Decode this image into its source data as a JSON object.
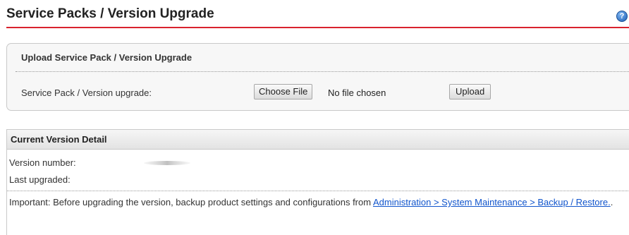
{
  "header": {
    "title": "Service Packs / Version Upgrade",
    "help_icon": "help-icon",
    "accent_color": "#d9232e"
  },
  "upload_panel": {
    "heading": "Upload Service Pack / Version Upgrade",
    "field_label": "Service Pack / Version upgrade:",
    "choose_file_label": "Choose File",
    "file_status": "No file chosen",
    "upload_label": "Upload"
  },
  "version_detail": {
    "heading": "Current Version Detail",
    "version_number_label": "Version number:",
    "version_number_value": "",
    "last_upgraded_label": "Last upgraded:",
    "last_upgraded_value": "",
    "note_prefix": "Important: Before upgrading the version, backup product settings and configurations from",
    "note_link": "Administration > System Maintenance > Backup / Restore.",
    "note_suffix": ".",
    "link_color": "#1155cc"
  }
}
